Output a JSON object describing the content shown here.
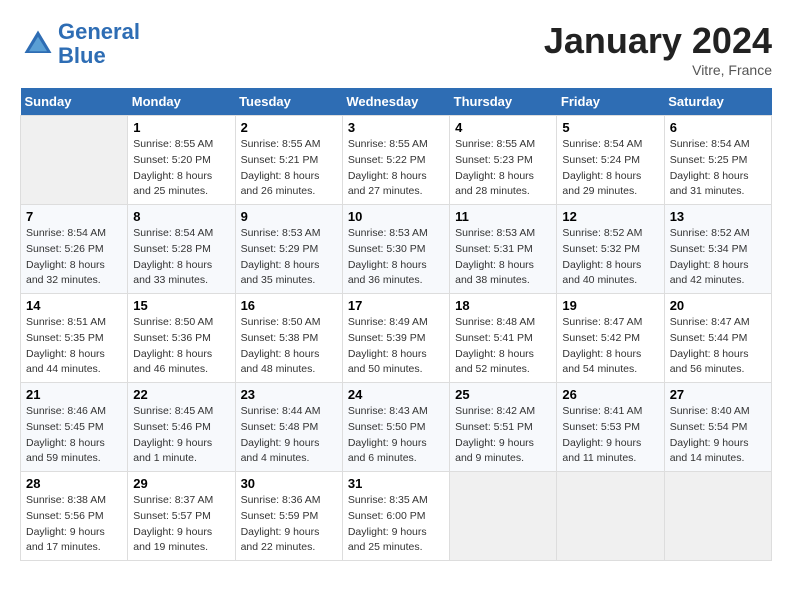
{
  "header": {
    "logo_line1": "General",
    "logo_line2": "Blue",
    "month": "January 2024",
    "location": "Vitre, France"
  },
  "weekdays": [
    "Sunday",
    "Monday",
    "Tuesday",
    "Wednesday",
    "Thursday",
    "Friday",
    "Saturday"
  ],
  "weeks": [
    [
      {
        "num": "",
        "sunrise": "",
        "sunset": "",
        "daylight": ""
      },
      {
        "num": "1",
        "sunrise": "Sunrise: 8:55 AM",
        "sunset": "Sunset: 5:20 PM",
        "daylight": "Daylight: 8 hours and 25 minutes."
      },
      {
        "num": "2",
        "sunrise": "Sunrise: 8:55 AM",
        "sunset": "Sunset: 5:21 PM",
        "daylight": "Daylight: 8 hours and 26 minutes."
      },
      {
        "num": "3",
        "sunrise": "Sunrise: 8:55 AM",
        "sunset": "Sunset: 5:22 PM",
        "daylight": "Daylight: 8 hours and 27 minutes."
      },
      {
        "num": "4",
        "sunrise": "Sunrise: 8:55 AM",
        "sunset": "Sunset: 5:23 PM",
        "daylight": "Daylight: 8 hours and 28 minutes."
      },
      {
        "num": "5",
        "sunrise": "Sunrise: 8:54 AM",
        "sunset": "Sunset: 5:24 PM",
        "daylight": "Daylight: 8 hours and 29 minutes."
      },
      {
        "num": "6",
        "sunrise": "Sunrise: 8:54 AM",
        "sunset": "Sunset: 5:25 PM",
        "daylight": "Daylight: 8 hours and 31 minutes."
      }
    ],
    [
      {
        "num": "7",
        "sunrise": "Sunrise: 8:54 AM",
        "sunset": "Sunset: 5:26 PM",
        "daylight": "Daylight: 8 hours and 32 minutes."
      },
      {
        "num": "8",
        "sunrise": "Sunrise: 8:54 AM",
        "sunset": "Sunset: 5:28 PM",
        "daylight": "Daylight: 8 hours and 33 minutes."
      },
      {
        "num": "9",
        "sunrise": "Sunrise: 8:53 AM",
        "sunset": "Sunset: 5:29 PM",
        "daylight": "Daylight: 8 hours and 35 minutes."
      },
      {
        "num": "10",
        "sunrise": "Sunrise: 8:53 AM",
        "sunset": "Sunset: 5:30 PM",
        "daylight": "Daylight: 8 hours and 36 minutes."
      },
      {
        "num": "11",
        "sunrise": "Sunrise: 8:53 AM",
        "sunset": "Sunset: 5:31 PM",
        "daylight": "Daylight: 8 hours and 38 minutes."
      },
      {
        "num": "12",
        "sunrise": "Sunrise: 8:52 AM",
        "sunset": "Sunset: 5:32 PM",
        "daylight": "Daylight: 8 hours and 40 minutes."
      },
      {
        "num": "13",
        "sunrise": "Sunrise: 8:52 AM",
        "sunset": "Sunset: 5:34 PM",
        "daylight": "Daylight: 8 hours and 42 minutes."
      }
    ],
    [
      {
        "num": "14",
        "sunrise": "Sunrise: 8:51 AM",
        "sunset": "Sunset: 5:35 PM",
        "daylight": "Daylight: 8 hours and 44 minutes."
      },
      {
        "num": "15",
        "sunrise": "Sunrise: 8:50 AM",
        "sunset": "Sunset: 5:36 PM",
        "daylight": "Daylight: 8 hours and 46 minutes."
      },
      {
        "num": "16",
        "sunrise": "Sunrise: 8:50 AM",
        "sunset": "Sunset: 5:38 PM",
        "daylight": "Daylight: 8 hours and 48 minutes."
      },
      {
        "num": "17",
        "sunrise": "Sunrise: 8:49 AM",
        "sunset": "Sunset: 5:39 PM",
        "daylight": "Daylight: 8 hours and 50 minutes."
      },
      {
        "num": "18",
        "sunrise": "Sunrise: 8:48 AM",
        "sunset": "Sunset: 5:41 PM",
        "daylight": "Daylight: 8 hours and 52 minutes."
      },
      {
        "num": "19",
        "sunrise": "Sunrise: 8:47 AM",
        "sunset": "Sunset: 5:42 PM",
        "daylight": "Daylight: 8 hours and 54 minutes."
      },
      {
        "num": "20",
        "sunrise": "Sunrise: 8:47 AM",
        "sunset": "Sunset: 5:44 PM",
        "daylight": "Daylight: 8 hours and 56 minutes."
      }
    ],
    [
      {
        "num": "21",
        "sunrise": "Sunrise: 8:46 AM",
        "sunset": "Sunset: 5:45 PM",
        "daylight": "Daylight: 8 hours and 59 minutes."
      },
      {
        "num": "22",
        "sunrise": "Sunrise: 8:45 AM",
        "sunset": "Sunset: 5:46 PM",
        "daylight": "Daylight: 9 hours and 1 minute."
      },
      {
        "num": "23",
        "sunrise": "Sunrise: 8:44 AM",
        "sunset": "Sunset: 5:48 PM",
        "daylight": "Daylight: 9 hours and 4 minutes."
      },
      {
        "num": "24",
        "sunrise": "Sunrise: 8:43 AM",
        "sunset": "Sunset: 5:50 PM",
        "daylight": "Daylight: 9 hours and 6 minutes."
      },
      {
        "num": "25",
        "sunrise": "Sunrise: 8:42 AM",
        "sunset": "Sunset: 5:51 PM",
        "daylight": "Daylight: 9 hours and 9 minutes."
      },
      {
        "num": "26",
        "sunrise": "Sunrise: 8:41 AM",
        "sunset": "Sunset: 5:53 PM",
        "daylight": "Daylight: 9 hours and 11 minutes."
      },
      {
        "num": "27",
        "sunrise": "Sunrise: 8:40 AM",
        "sunset": "Sunset: 5:54 PM",
        "daylight": "Daylight: 9 hours and 14 minutes."
      }
    ],
    [
      {
        "num": "28",
        "sunrise": "Sunrise: 8:38 AM",
        "sunset": "Sunset: 5:56 PM",
        "daylight": "Daylight: 9 hours and 17 minutes."
      },
      {
        "num": "29",
        "sunrise": "Sunrise: 8:37 AM",
        "sunset": "Sunset: 5:57 PM",
        "daylight": "Daylight: 9 hours and 19 minutes."
      },
      {
        "num": "30",
        "sunrise": "Sunrise: 8:36 AM",
        "sunset": "Sunset: 5:59 PM",
        "daylight": "Daylight: 9 hours and 22 minutes."
      },
      {
        "num": "31",
        "sunrise": "Sunrise: 8:35 AM",
        "sunset": "Sunset: 6:00 PM",
        "daylight": "Daylight: 9 hours and 25 minutes."
      },
      {
        "num": "",
        "sunrise": "",
        "sunset": "",
        "daylight": ""
      },
      {
        "num": "",
        "sunrise": "",
        "sunset": "",
        "daylight": ""
      },
      {
        "num": "",
        "sunrise": "",
        "sunset": "",
        "daylight": ""
      }
    ]
  ]
}
